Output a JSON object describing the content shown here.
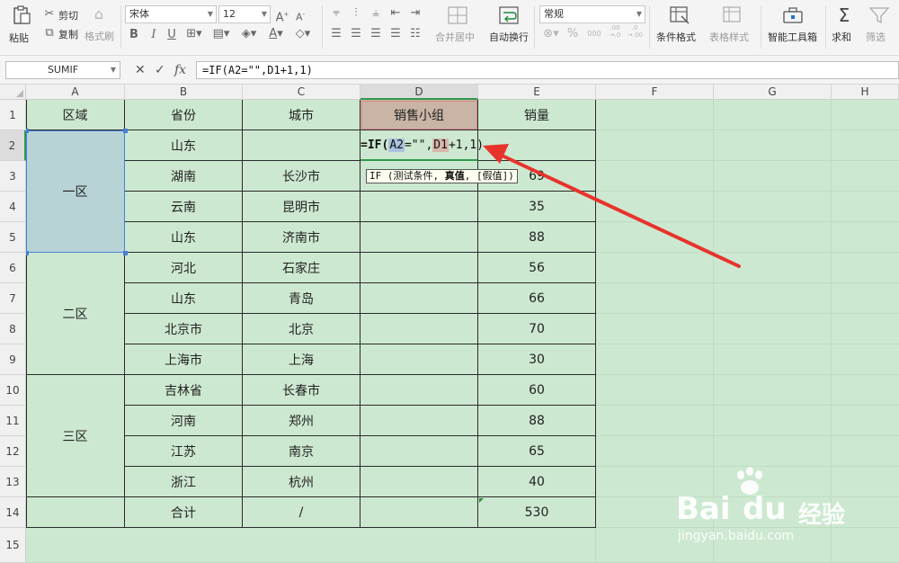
{
  "ribbon": {
    "paste": "粘贴",
    "cut": "剪切",
    "copy": "复制",
    "format_painter": "格式刷",
    "font_name": "宋体",
    "font_size": "12",
    "merge_center": "合并居中",
    "wrap_text": "自动换行",
    "number_format": "常规",
    "conditional_format": "条件格式",
    "table_style": "表格样式",
    "smart_toolbox": "智能工具箱",
    "sum": "求和",
    "filter": "筛选",
    "decimal_inc": ".00\n→.0",
    "decimal_dec": ".0\n→.00",
    "thousands": "000"
  },
  "formula_bar": {
    "name_box": "SUMIF",
    "cancel": "✕",
    "confirm": "✓",
    "fx": "fx",
    "formula": "=IF(A2=\"\",D1+1,1)"
  },
  "columns": [
    "A",
    "B",
    "C",
    "D",
    "E",
    "F",
    "G",
    "H"
  ],
  "rows": [
    "1",
    "2",
    "3",
    "4",
    "5",
    "6",
    "7",
    "8",
    "9",
    "10",
    "11",
    "12",
    "13",
    "14",
    "15"
  ],
  "table": {
    "headers": [
      "区域",
      "省份",
      "城市",
      "销售小组",
      "销量"
    ],
    "regions": [
      "一区",
      "二区",
      "三区"
    ],
    "records": [
      {
        "province": "山东",
        "city": "",
        "sales": ""
      },
      {
        "province": "湖南",
        "city": "长沙市",
        "sales": "69"
      },
      {
        "province": "云南",
        "city": "昆明市",
        "sales": "35"
      },
      {
        "province": "山东",
        "city": "济南市",
        "sales": "88"
      },
      {
        "province": "河北",
        "city": "石家庄",
        "sales": "56"
      },
      {
        "province": "山东",
        "city": "青岛",
        "sales": "66"
      },
      {
        "province": "北京市",
        "city": "北京",
        "sales": "70"
      },
      {
        "province": "上海市",
        "city": "上海",
        "sales": "30"
      },
      {
        "province": "吉林省",
        "city": "长春市",
        "sales": "60"
      },
      {
        "province": "河南",
        "city": "郑州",
        "sales": "88"
      },
      {
        "province": "江苏",
        "city": "南京",
        "sales": "65"
      },
      {
        "province": "浙江",
        "city": "杭州",
        "sales": "40"
      }
    ],
    "total": {
      "label": "合计",
      "city": "/",
      "sales": "530"
    }
  },
  "editing_cell": {
    "prefix": "=IF(",
    "ref_a": "A2",
    "mid": "=\"\",",
    "ref_d": "D1",
    "suffix": "+1,1)"
  },
  "tooltip": {
    "prefix": "IF (测试条件, ",
    "bold": "真值",
    "suffix": ", [假值])"
  },
  "watermark": {
    "brand": "Bai",
    "brand2": "du",
    "cn": "经验",
    "url": "jingyan.baidu.com"
  },
  "colors": {
    "sheet": "#cde8d0",
    "selected_header": "#c9b4a6",
    "selected_range": "#b8d3d6",
    "arrow": "#e8332c"
  }
}
